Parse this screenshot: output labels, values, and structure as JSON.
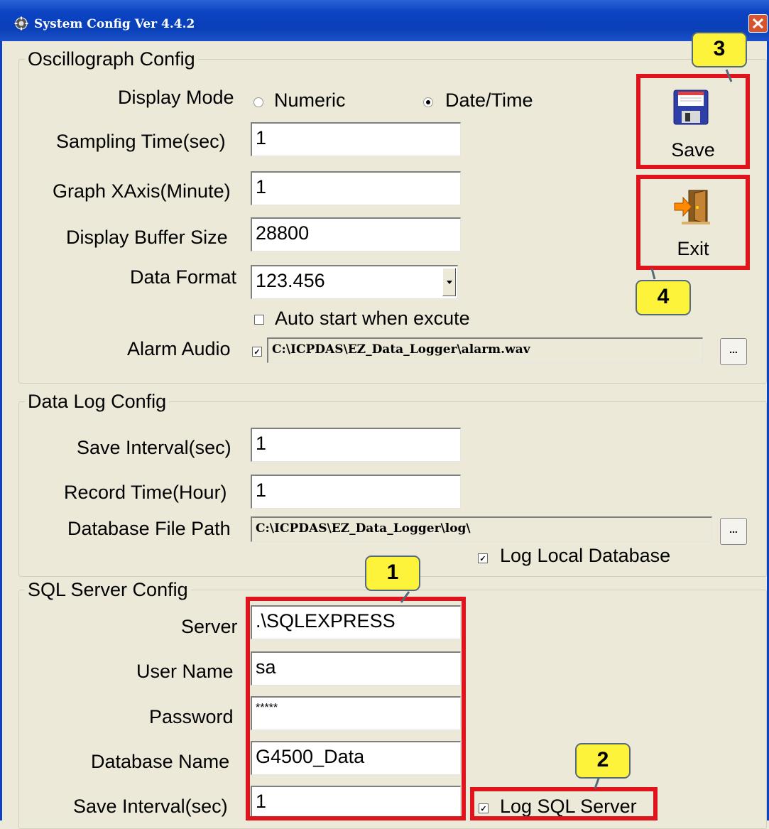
{
  "window": {
    "title": "System Config Ver 4.4.2"
  },
  "oscillograph": {
    "title": "Oscillograph Config",
    "display_mode_label": "Display Mode",
    "mode_numeric": "Numeric",
    "mode_datetime": "Date/Time",
    "selected_mode": "Date/Time",
    "sampling_time_label": "Sampling Time(sec)",
    "sampling_time_value": "1",
    "graph_xaxis_label": "Graph XAxis(Minute)",
    "graph_xaxis_value": "1",
    "buffer_size_label": "Display Buffer Size",
    "buffer_size_value": "28800",
    "data_format_label": "Data Format",
    "data_format_value": "123.456",
    "auto_start_label": "Auto start when excute",
    "auto_start_checked": false,
    "alarm_audio_label": "Alarm Audio",
    "alarm_audio_checked": true,
    "alarm_audio_path": "C:\\ICPDAS\\EZ_Data_Logger\\alarm.wav",
    "browse_label": "..."
  },
  "datalog": {
    "title": "Data Log Config",
    "save_interval_label": "Save Interval(sec)",
    "save_interval_value": "1",
    "record_time_label": "Record Time(Hour)",
    "record_time_value": "1",
    "db_path_label": "Database File Path",
    "db_path_value": "C:\\ICPDAS\\EZ_Data_Logger\\log\\",
    "browse_label": "...",
    "log_local_label": "Log Local Database",
    "log_local_checked": true
  },
  "sql": {
    "title": "SQL Server Config",
    "server_label": "Server",
    "server_value": ".\\SQLEXPRESS",
    "user_label": "User Name",
    "user_value": "sa",
    "password_label": "Password",
    "password_value": "*****",
    "dbname_label": "Database Name",
    "dbname_value": "G4500_Data",
    "save_interval_label": "Save Interval(sec)",
    "save_interval_value": "1",
    "log_sql_label": "Log SQL Server",
    "log_sql_checked": true
  },
  "buttons": {
    "save_label": "Save",
    "exit_label": "Exit"
  },
  "callouts": [
    "1",
    "2",
    "3",
    "4"
  ],
  "colors": {
    "highlight": "#e0141c",
    "callout": "#fdf33a",
    "titlebar": "#0a3fb8",
    "face": "#ece9d8"
  },
  "icons": [
    "gear-icon",
    "close-icon",
    "floppy-disk-icon",
    "exit-door-icon"
  ]
}
